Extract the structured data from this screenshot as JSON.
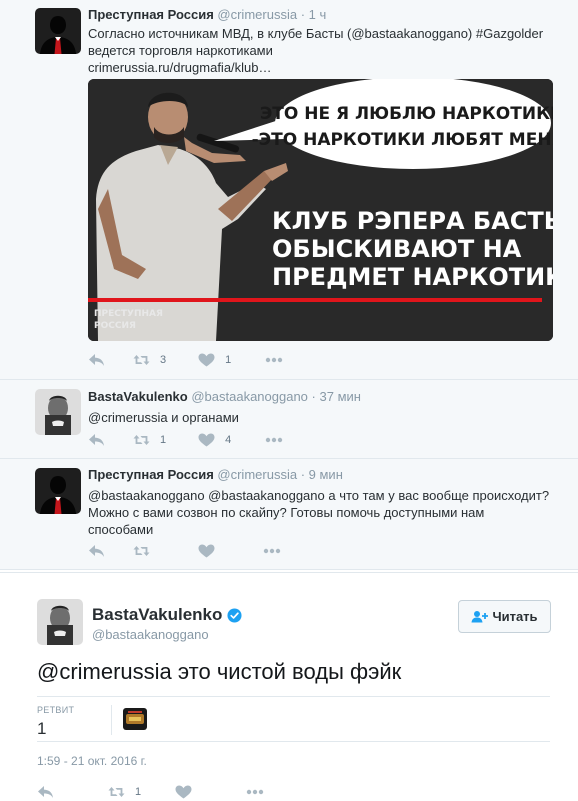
{
  "tweets": [
    {
      "fullname": "Преступная Россия",
      "username": "@crimerussia",
      "separator": "·",
      "time": "1 ч",
      "text_line1": "Согласно источникам МВД, в клубе Басты (@bastaakanoggano) #Gazgolder",
      "text_line2": "ведется торговля наркотиками",
      "text_line3": "crimerussia.ru/drugmafia/klub…",
      "retweets": "3",
      "likes": "1",
      "media": {
        "bubble_line1": "ЭТО НЕ Я ЛЮБЛЮ НАРКОТИКИ",
        "bubble_line2": "-ЭТО НАРКОТИКИ ЛЮБЯТ МЕНЯ!",
        "headline1": "КЛУБ РЭПЕРА БАСТЫ",
        "headline2": "ОБЫСКИВАЮТ НА",
        "headline3": "ПРЕДМЕТ НАРКОТИКОВ",
        "logo_line1": "ПРЕСТУПНАЯ",
        "logo_line2": "РОССИЯ"
      }
    },
    {
      "fullname": "BastaVakulenko",
      "username": "@bastaakanoggano",
      "separator": "·",
      "time": "37 мин",
      "text_line1": "@crimerussia и органами",
      "retweets": "1",
      "likes": "4"
    },
    {
      "fullname": "Преступная Россия",
      "username": "@crimerussia",
      "separator": "·",
      "time": "9 мин",
      "text_line1": "@bastaakanoggano @bastaakanoggano а что там у вас вообще происходит?",
      "text_line2": "Можно с вами созвон по скайпу? Готовы помочь доступными нам",
      "text_line3": "способами"
    }
  ],
  "main": {
    "fullname": "BastaVakulenko",
    "username": "@bastaakanoggano",
    "follow_label": "Читать",
    "text": "@crimerussia это чистой воды фэйк",
    "retweet_label": "РЕТВИТ",
    "retweet_count": "1",
    "datetime": "1:59 - 21 окт. 2016 г.",
    "action_retweets": "1"
  },
  "colors": {
    "verified": "#1da1f2",
    "red_bar": "#e0151b",
    "muted": "#8899a6",
    "icon": "#aab8c2"
  },
  "icons": [
    "reply-icon",
    "retweet-icon",
    "heart-icon",
    "more-icon",
    "verified-icon",
    "follow-user-icon"
  ]
}
